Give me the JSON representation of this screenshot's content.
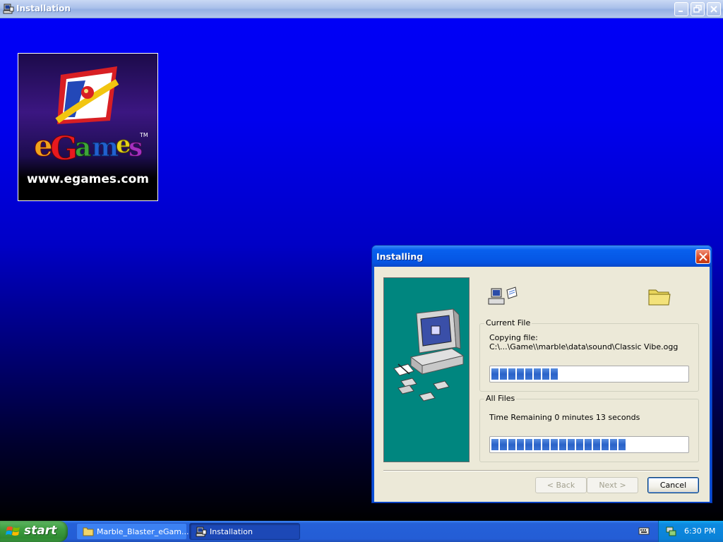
{
  "window": {
    "title": "Installation"
  },
  "logo": {
    "brand": "eGames",
    "url": "www.egames.com"
  },
  "dialog": {
    "title": "Installing",
    "current_file": {
      "legend": "Current File",
      "line1": "Copying file:",
      "line2": "C:\\...\\Game\\\\marble\\data\\sound\\Classic Vibe.ogg",
      "progress": 0.38
    },
    "all_files": {
      "legend": "All Files",
      "time_remaining": "Time Remaining 0 minutes 13 seconds",
      "progress": 0.7
    },
    "buttons": {
      "back": "< Back",
      "next": "Next >",
      "cancel": "Cancel"
    }
  },
  "taskbar": {
    "start_label": "start",
    "tasks": [
      {
        "label": "Marble_Blaster_eGam...",
        "icon": "folder-icon",
        "active": false
      },
      {
        "label": "Installation",
        "icon": "installer-icon",
        "active": true
      }
    ],
    "clock": "6:30 PM"
  },
  "colors": {
    "desktop_top": "#0000f6",
    "dialog_title": "#0554e2",
    "side_panel": "#00867f",
    "progress_block": "#2a63c8",
    "dialog_body": "#ece9d8"
  }
}
